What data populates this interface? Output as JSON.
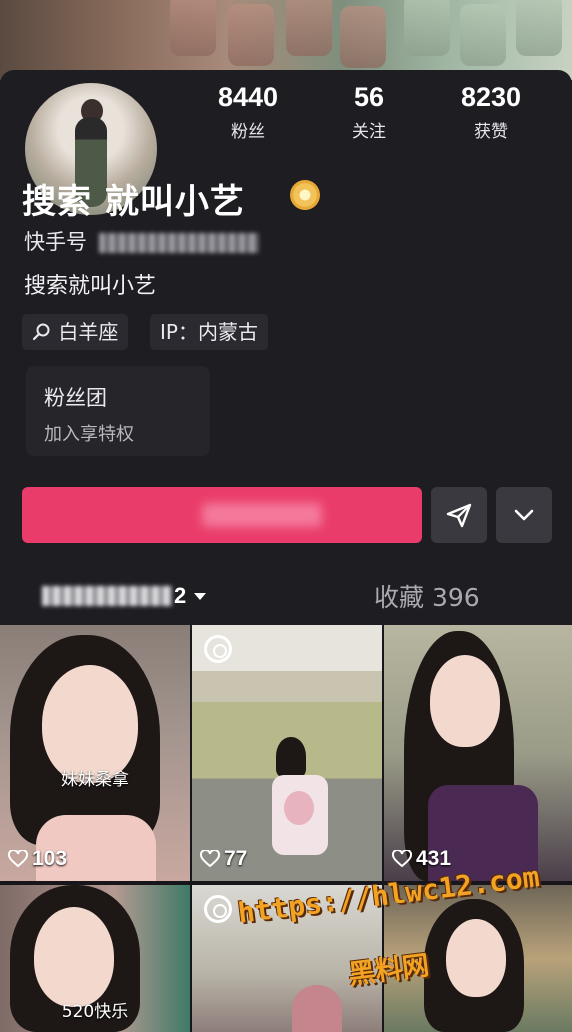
{
  "profile": {
    "stats": [
      {
        "value": "8440",
        "label": "粉丝"
      },
      {
        "value": "56",
        "label": "关注"
      },
      {
        "value": "8230",
        "label": "获赞"
      }
    ],
    "name": "搜索 就叫小艺",
    "kuaishou_id_label": "快手号",
    "bio": "搜索就叫小艺",
    "tags": [
      {
        "icon": "search-icon",
        "text": "白羊座"
      },
      {
        "text": "IP：内蒙古"
      }
    ]
  },
  "fan_club": {
    "title": "粉丝团",
    "subtitle": "加入享特权"
  },
  "actions": {
    "follow_color": "#ea3c6a",
    "share_icon": "send-icon",
    "more_icon": "chevron-down-icon"
  },
  "tabs": {
    "active_suffix": "2",
    "collection": "收藏 396"
  },
  "posts": [
    {
      "caption": "妹妹桑拿",
      "likes": "103",
      "pinned": false
    },
    {
      "caption": "",
      "likes": "77",
      "pinned": true
    },
    {
      "caption": "",
      "likes": "431",
      "pinned": false
    },
    {
      "caption": "520快乐",
      "likes": "",
      "pinned": false
    },
    {
      "caption": "",
      "likes": "",
      "pinned": true
    },
    {
      "caption": "",
      "likes": "",
      "pinned": false
    }
  ],
  "watermark": {
    "url": "https://hlwc12.com",
    "name": "黑料网"
  }
}
